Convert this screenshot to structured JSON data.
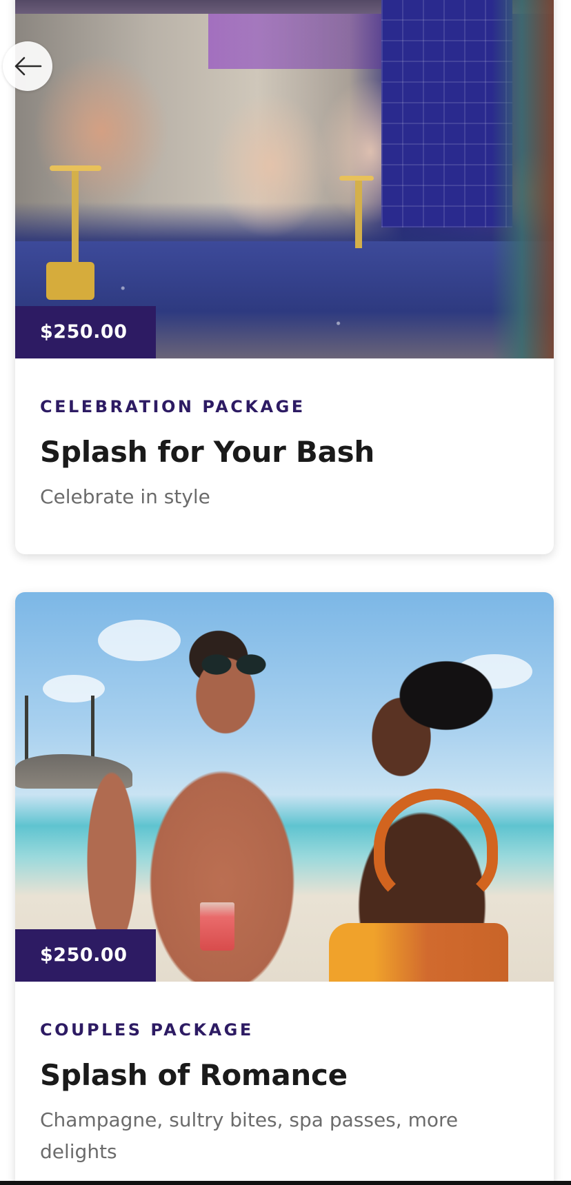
{
  "navigation": {
    "back_icon": "arrow-left-icon"
  },
  "packages": [
    {
      "price": "$250.00",
      "category": "CELEBRATION PACKAGE",
      "title": "Splash for Your Bash",
      "description": "Celebrate in style",
      "image": "group-toasting-at-bar"
    },
    {
      "price": "$250.00",
      "category": "COUPLES PACKAGE",
      "title": "Splash of Romance",
      "description": "Champagne, sultry bites, spa passes, more delights",
      "image": "couple-on-beach"
    }
  ],
  "colors": {
    "brand_purple": "#2d1b63",
    "title_text": "#1a1a1a",
    "muted_text": "#6b6b6b"
  }
}
